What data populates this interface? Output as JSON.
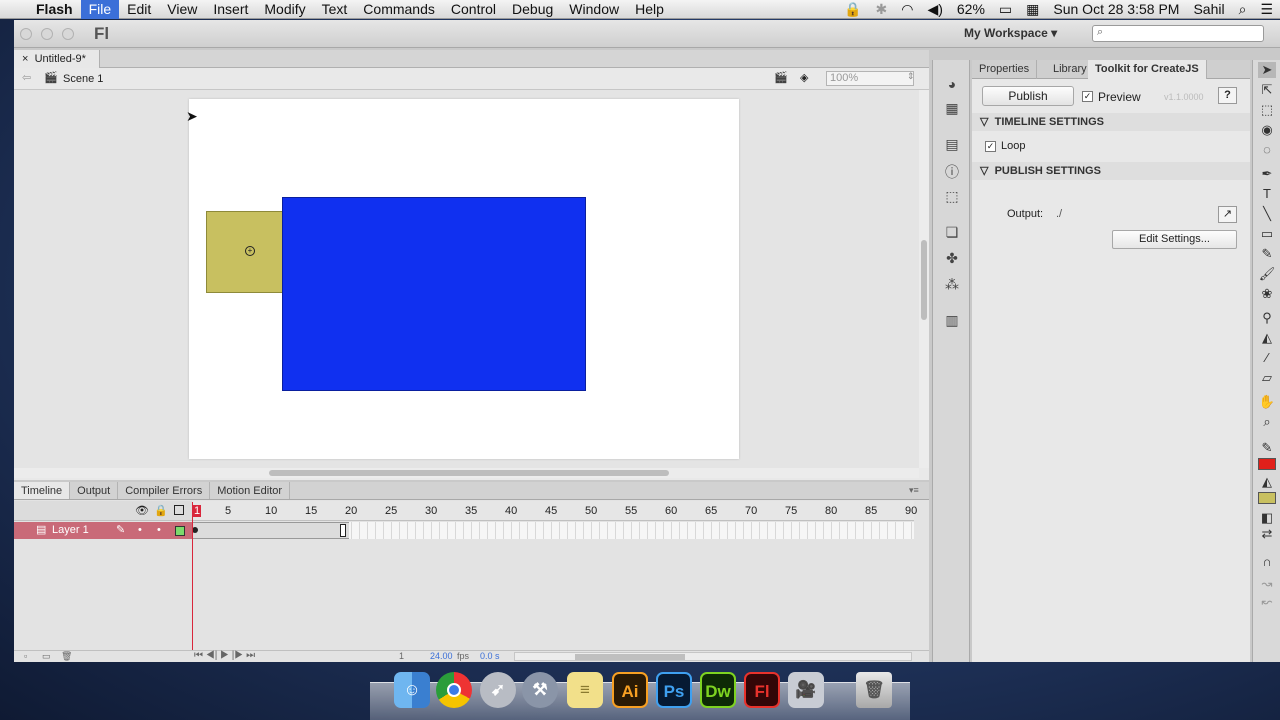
{
  "menubar": {
    "app": "Flash",
    "items": [
      "File",
      "Edit",
      "View",
      "Insert",
      "Modify",
      "Text",
      "Commands",
      "Control",
      "Debug",
      "Window",
      "Help"
    ],
    "selected": "File",
    "battery": "62%",
    "datetime": "Sun Oct 28  3:58 PM",
    "user": "Sahil"
  },
  "app": {
    "logo": "Fl",
    "workspace": "My Workspace"
  },
  "document": {
    "tab": "Untitled-9*",
    "scene": "Scene 1",
    "zoom": "100%"
  },
  "stage": {
    "yellow_rect_color": "#c8c060",
    "blue_rect_color": "#1030f0",
    "stage_color": "#ffffff"
  },
  "timeline": {
    "tabs": [
      "Timeline",
      "Output",
      "Compiler Errors",
      "Motion Editor"
    ],
    "layer": "Layer 1",
    "ruler": [
      "1",
      "5",
      "10",
      "15",
      "20",
      "25",
      "30",
      "35",
      "40",
      "45",
      "50",
      "55",
      "60",
      "65",
      "70",
      "75",
      "80",
      "85",
      "90"
    ],
    "frame": "1",
    "fps": "24.00",
    "fps_unit": "fps",
    "time": "0.0 s"
  },
  "panel": {
    "tabs": [
      "Properties",
      "Library",
      "Toolkit for CreateJS"
    ],
    "publish": "Publish",
    "preview": "Preview",
    "version": "v1.1.0000",
    "help": "?",
    "timeline_settings": "TIMELINE SETTINGS",
    "loop": "Loop",
    "publish_settings": "PUBLISH SETTINGS",
    "output_label": "Output:",
    "output_value": "./",
    "edit_settings": "Edit Settings..."
  },
  "tools": {
    "stroke_color": "#e0201a",
    "fill_color": "#c8c060"
  },
  "dock": [
    "Finder",
    "Chrome",
    "Launchpad",
    "Xcode",
    "Stickies",
    "Ai",
    "Ps",
    "Dw",
    "Fl",
    "Photo Booth",
    "Trash"
  ]
}
